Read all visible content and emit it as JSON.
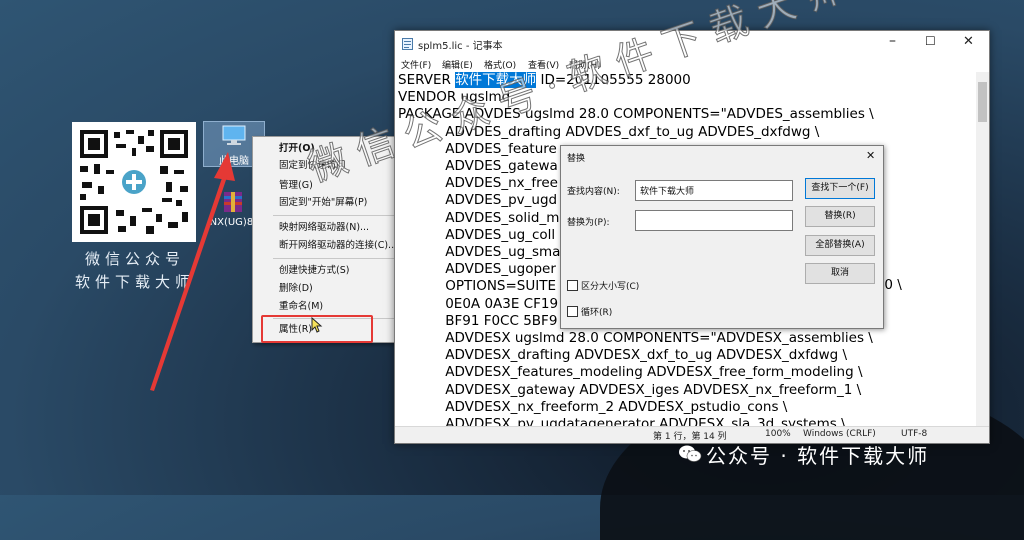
{
  "desktop": {
    "qr_caption_line1": "微信公众号",
    "qr_caption_line2": "软件下载大师",
    "icons": [
      {
        "label": "此电脑",
        "icon": "computer-icon"
      },
      {
        "label": "NX(UG)8.",
        "icon": "winrar-archive-icon"
      }
    ]
  },
  "context_menu": {
    "items": [
      "打开(O)",
      "固定到快速访问",
      "管理(G)",
      "固定到\"开始\"屏幕(P)",
      "映射网络驱动器(N)...",
      "断开网络驱动器的连接(C)...",
      "创建快捷方式(S)",
      "删除(D)",
      "重命名(M)",
      "属性(R)"
    ],
    "highlight_color": "#e53935"
  },
  "notepad": {
    "title": "splm5.lic - 记事本",
    "menu": [
      "文件(F)",
      "编辑(E)",
      "格式(O)",
      "查看(V)",
      "帮助(H)"
    ],
    "lines": [
      {
        "pre": "SERVER ",
        "hl": "软件下载大师",
        "post": " ID=201105555 28000"
      },
      {
        "pre": "VENDOR ugslmd"
      },
      {
        "pre": "PACKAGE ADVDES ugslmd 28.0 COMPONENTS=\"ADVDES_assemblies \\"
      },
      {
        "pre": "           ADVDES_drafting ADVDES_dxf_to_ug ADVDES_dxfdwg \\"
      },
      {
        "pre": "           ADVDES_feature"
      },
      {
        "pre": "           ADVDES_gatewa"
      },
      {
        "pre": "           ADVDES_nx_free"
      },
      {
        "pre": "           ADVDES_pv_ugd"
      },
      {
        "pre": "           ADVDES_solid_m"
      },
      {
        "pre": "           ADVDES_ug_coll"
      },
      {
        "pre": "           ADVDES_ug_sma"
      },
      {
        "pre": "           ADVDES_ugoper"
      },
      {
        "pre": "           OPTIONS=SUITE"
      },
      {
        "pre": "           0E0A 0A3E CF19"
      },
      {
        "pre": "           BF91 F0CC 5BF9"
      },
      {
        "pre": "           ADVDESX ugslmd 28.0 COMPONENTS=\"ADVDESX_assemblies \\"
      },
      {
        "pre": "           ADVDESX_drafting ADVDESX_dxf_to_ug ADVDESX_dxfdwg \\"
      },
      {
        "pre": "           ADVDESX_features_modeling ADVDESX_free_form_modeling \\"
      },
      {
        "pre": "           ADVDESX_gateway ADVDESX_iges ADVDESX_nx_freeform_1 \\"
      },
      {
        "pre": "           ADVDESX_nx_freeform_2 ADVDESX_pstudio_cons \\"
      },
      {
        "pre": "           ADVDESX_pv_ugdatagenerator ADVDESX_sla_3d_systems \\"
      }
    ],
    "right_fragment": "C0 \\",
    "status": {
      "position": "第 1 行，第 14 列",
      "zoom": "100%",
      "line_ending": "Windows (CRLF)",
      "encoding": "UTF-8"
    }
  },
  "replace_dialog": {
    "title": "替换",
    "find_label": "查找内容(N):",
    "find_value": "软件下载大师",
    "replace_label": "替换为(P):",
    "replace_value": "",
    "buttons": [
      "查找下一个(F)",
      "替换(R)",
      "全部替换(A)",
      "取消"
    ],
    "match_case": "区分大小写(C)",
    "wrap": "循环(R)"
  },
  "watermark": {
    "big": "微信公众号·软件下载大师",
    "bottom": "公众号 · 软件下载大师"
  }
}
